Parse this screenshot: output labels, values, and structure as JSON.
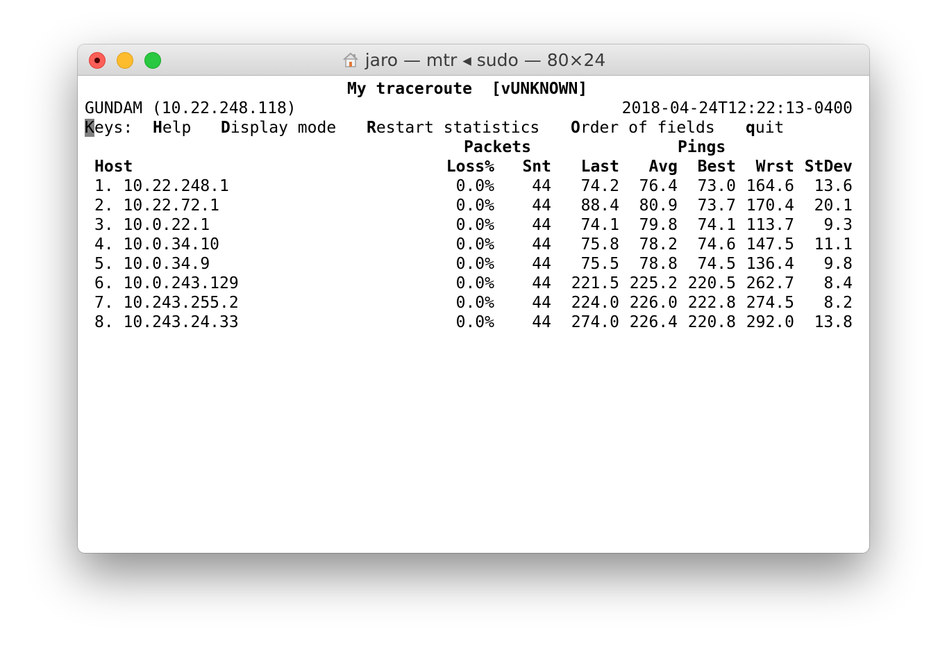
{
  "window": {
    "title": "jaro — mtr ◂ sudo — 80×24"
  },
  "terminal": {
    "header_title": "My traceroute  [vUNKNOWN]",
    "hostname": "GUNDAM (10.22.248.118)",
    "timestamp": "2018-04-24T12:22:13-0400",
    "keys": {
      "cursor": "K",
      "label_rest": "eys:",
      "help_key": "H",
      "help_rest": "elp",
      "display_key": "D",
      "display_rest": "isplay mode",
      "restart_key": "R",
      "restart_rest": "estart statistics",
      "order_key": "O",
      "order_rest": "rder of fields",
      "quit_key": "q",
      "quit_rest": "uit"
    },
    "group_headers": {
      "packets": "Packets",
      "pings": "Pings"
    },
    "columns": {
      "host": "Host",
      "loss": "Loss%",
      "snt": "Snt",
      "last": "Last",
      "avg": "Avg",
      "best": "Best",
      "wrst": "Wrst",
      "stdev": "StDev"
    },
    "rows": [
      {
        "host": "1. 10.22.248.1",
        "loss": "0.0%",
        "snt": "44",
        "last": "74.2",
        "avg": "76.4",
        "best": "73.0",
        "wrst": "164.6",
        "stdev": "13.6"
      },
      {
        "host": "2. 10.22.72.1",
        "loss": "0.0%",
        "snt": "44",
        "last": "88.4",
        "avg": "80.9",
        "best": "73.7",
        "wrst": "170.4",
        "stdev": "20.1"
      },
      {
        "host": "3. 10.0.22.1",
        "loss": "0.0%",
        "snt": "44",
        "last": "74.1",
        "avg": "79.8",
        "best": "74.1",
        "wrst": "113.7",
        "stdev": "9.3"
      },
      {
        "host": "4. 10.0.34.10",
        "loss": "0.0%",
        "snt": "44",
        "last": "75.8",
        "avg": "78.2",
        "best": "74.6",
        "wrst": "147.5",
        "stdev": "11.1"
      },
      {
        "host": "5. 10.0.34.9",
        "loss": "0.0%",
        "snt": "44",
        "last": "75.5",
        "avg": "78.8",
        "best": "74.5",
        "wrst": "136.4",
        "stdev": "9.8"
      },
      {
        "host": "6. 10.0.243.129",
        "loss": "0.0%",
        "snt": "44",
        "last": "221.5",
        "avg": "225.2",
        "best": "220.5",
        "wrst": "262.7",
        "stdev": "8.4"
      },
      {
        "host": "7. 10.243.255.2",
        "loss": "0.0%",
        "snt": "44",
        "last": "224.0",
        "avg": "226.0",
        "best": "222.8",
        "wrst": "274.5",
        "stdev": "8.2"
      },
      {
        "host": "8. 10.243.24.33",
        "loss": "0.0%",
        "snt": "44",
        "last": "274.0",
        "avg": "226.4",
        "best": "220.8",
        "wrst": "292.0",
        "stdev": "13.8"
      }
    ]
  }
}
